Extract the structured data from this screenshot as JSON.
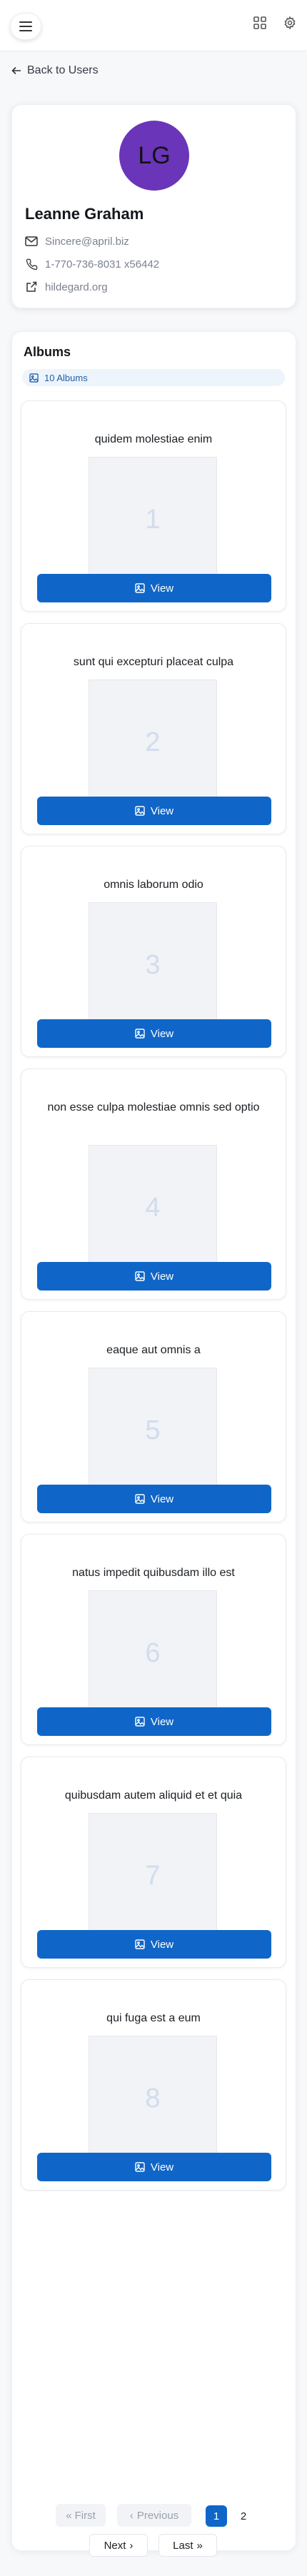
{
  "header": {
    "menu_icon": "hamburger-icon",
    "grid_icon": "grid-icon",
    "settings_icon": "gear-icon"
  },
  "back_link": {
    "label": "Back to Users",
    "icon": "arrow-left-icon"
  },
  "user": {
    "initials": "LG",
    "name": "Leanne Graham",
    "email": "Sincere@april.biz",
    "phone": "1-770-736-8031 x56442",
    "website": "hildegard.org",
    "avatar_color": "#6a35b8"
  },
  "albums": {
    "title": "Albums",
    "count_label": "10 Albums",
    "view_label": "View",
    "items": [
      {
        "title": "quidem molestiae enim",
        "number": "1"
      },
      {
        "title": "sunt qui excepturi placeat culpa",
        "number": "2"
      },
      {
        "title": "omnis laborum odio",
        "number": "3"
      },
      {
        "title": "non esse culpa molestiae omnis sed optio",
        "number": "4"
      },
      {
        "title": "eaque aut omnis a",
        "number": "5"
      },
      {
        "title": "natus impedit quibusdam illo est",
        "number": "6"
      },
      {
        "title": "quibusdam autem aliquid et et quia",
        "number": "7"
      },
      {
        "title": "qui fuga est a eum",
        "number": "8"
      }
    ]
  },
  "pagination": {
    "first": "First",
    "previous": "Previous",
    "pages": [
      "1",
      "2"
    ],
    "current": "1",
    "next": "Next",
    "last": "Last"
  },
  "colors": {
    "primary": "#0f66c8",
    "badge_bg": "#eef4fb"
  }
}
